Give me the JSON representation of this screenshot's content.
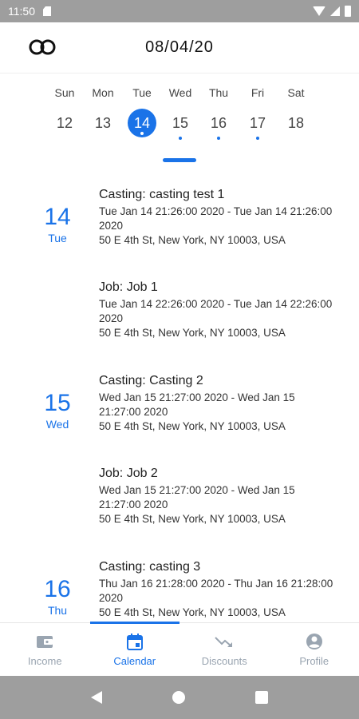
{
  "status_bar": {
    "time": "11:50"
  },
  "header": {
    "title": "08/04/20"
  },
  "week": {
    "days": [
      {
        "name": "Sun",
        "num": "12",
        "selected": false,
        "dot": false
      },
      {
        "name": "Mon",
        "num": "13",
        "selected": false,
        "dot": false
      },
      {
        "name": "Tue",
        "num": "14",
        "selected": true,
        "dot": true
      },
      {
        "name": "Wed",
        "num": "15",
        "selected": false,
        "dot": true
      },
      {
        "name": "Thu",
        "num": "16",
        "selected": false,
        "dot": true
      },
      {
        "name": "Fri",
        "num": "17",
        "selected": false,
        "dot": true
      },
      {
        "name": "Sat",
        "num": "18",
        "selected": false,
        "dot": false
      }
    ]
  },
  "events": [
    {
      "date_num": "14",
      "date_day": "Tue",
      "title": "Casting: casting test 1",
      "time": "Tue Jan 14 21:26:00 2020 - Tue Jan 14 21:26:00 2020",
      "address": "50 E 4th St, New York, NY 10003, USA"
    },
    {
      "date_num": "",
      "date_day": "",
      "title": "Job: Job 1",
      "time": "Tue Jan 14 22:26:00 2020 - Tue Jan 14 22:26:00 2020",
      "address": "50 E 4th St, New York, NY 10003, USA"
    },
    {
      "date_num": "15",
      "date_day": "Wed",
      "title": "Casting: Casting 2",
      "time": "Wed Jan 15 21:27:00 2020 - Wed Jan 15 21:27:00 2020",
      "address": "50 E 4th St, New York, NY 10003, USA"
    },
    {
      "date_num": "",
      "date_day": "",
      "title": "Job: Job 2",
      "time": "Wed Jan 15 21:27:00 2020 - Wed Jan 15 21:27:00 2020",
      "address": "50 E 4th St, New York, NY 10003, USA"
    },
    {
      "date_num": "16",
      "date_day": "Thu",
      "title": "Casting: casting 3",
      "time": "Thu Jan 16 21:28:00 2020 - Thu Jan 16 21:28:00 2020",
      "address": "50 E 4th St, New York, NY 10003, USA"
    }
  ],
  "nav": {
    "items": [
      {
        "label": "Income",
        "icon": "wallet-icon",
        "active": false
      },
      {
        "label": "Calendar",
        "icon": "calendar-icon",
        "active": true
      },
      {
        "label": "Discounts",
        "icon": "trending-down-icon",
        "active": false
      },
      {
        "label": "Profile",
        "icon": "account-circle-icon",
        "active": false
      }
    ]
  },
  "colors": {
    "accent": "#1a73e8",
    "inactive": "#9aa5b1",
    "system_bar": "#9e9e9e"
  }
}
